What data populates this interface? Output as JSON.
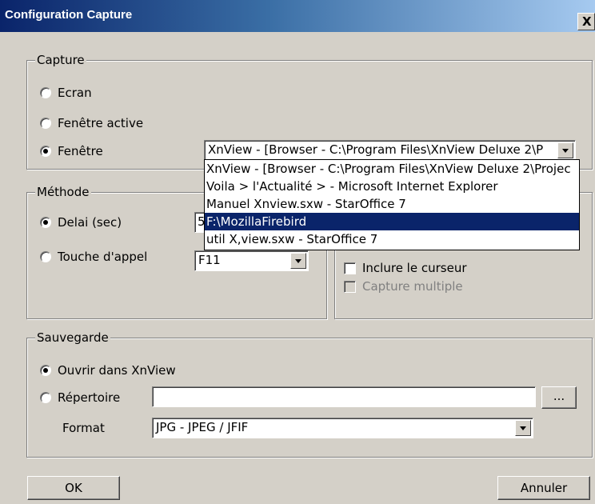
{
  "window": {
    "title": "Configuration Capture",
    "close_label": "X"
  },
  "capture": {
    "legend": "Capture",
    "options": [
      "Ecran",
      "Fenêtre active",
      "Fenêtre"
    ],
    "selected": "Fenêtre",
    "window_dropdown": {
      "value": "XnView - [Browser - C:\\Program Files\\XnView Deluxe 2\\P",
      "items": [
        "XnView - [Browser - C:\\Program Files\\XnView Deluxe 2\\Projec",
        "Voila > l'Actualité > - Microsoft Internet Explorer",
        "Manuel Xnview.sxw - StarOffice 7",
        "F:\\MozillaFirebird",
        "util X,view.sxw - StarOffice 7"
      ],
      "highlighted_index": 3
    }
  },
  "methode": {
    "legend": "Méthode",
    "delay_label": "Delai (sec)",
    "delay_value": "5",
    "hotkey_label": "Touche d'appel",
    "hotkey_value": "F11",
    "selected": "Delai (sec)"
  },
  "options": {
    "include_cursor_label": "Inclure le curseur",
    "multiple_capture_label": "Capture multiple"
  },
  "sauvegarde": {
    "legend": "Sauvegarde",
    "open_label": "Ouvrir dans XnView",
    "dir_label": "Répertoire",
    "dir_value": "",
    "browse_label": "...",
    "format_label": "Format",
    "format_value": "JPG - JPEG / JFIF",
    "selected": "Ouvrir dans XnView"
  },
  "buttons": {
    "ok": "OK",
    "cancel": "Annuler"
  }
}
